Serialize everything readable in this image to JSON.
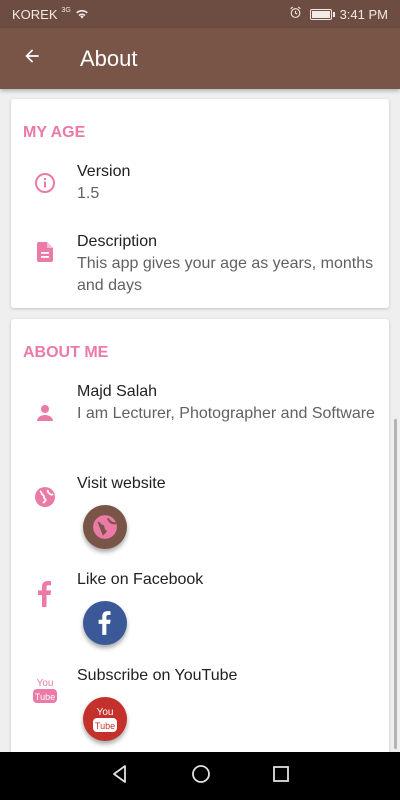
{
  "status_bar": {
    "carrier": "KOREK",
    "network": "3G",
    "time": "3:41 PM",
    "battery_level": 0.9
  },
  "app_bar": {
    "title": "About",
    "back_icon": "arrow-back-icon"
  },
  "sections": {
    "my_age": {
      "header": "MY AGE",
      "version": {
        "title": "Version",
        "value": "1.5",
        "icon": "info-icon"
      },
      "description": {
        "title": "Description",
        "value": "This app gives your age as years, months and days",
        "icon": "document-icon"
      }
    },
    "about_me": {
      "header": "ABOUT ME",
      "author": {
        "title": "Majd Salah",
        "value": "I am Lecturer, Photographer and Software",
        "icon": "person-icon"
      },
      "website": {
        "title": "Visit website",
        "icon": "globe-icon"
      },
      "facebook": {
        "title": "Like on Facebook",
        "icon": "facebook-icon"
      },
      "youtube": {
        "title": "Subscribe on YouTube",
        "icon": "youtube-icon",
        "logo_text": "You\nTube"
      }
    }
  },
  "colors": {
    "status_bar": "#6d4c41",
    "app_bar": "#795548",
    "accent": "#ec7aa7",
    "facebook": "#3b5998",
    "youtube": "#c4302b"
  }
}
